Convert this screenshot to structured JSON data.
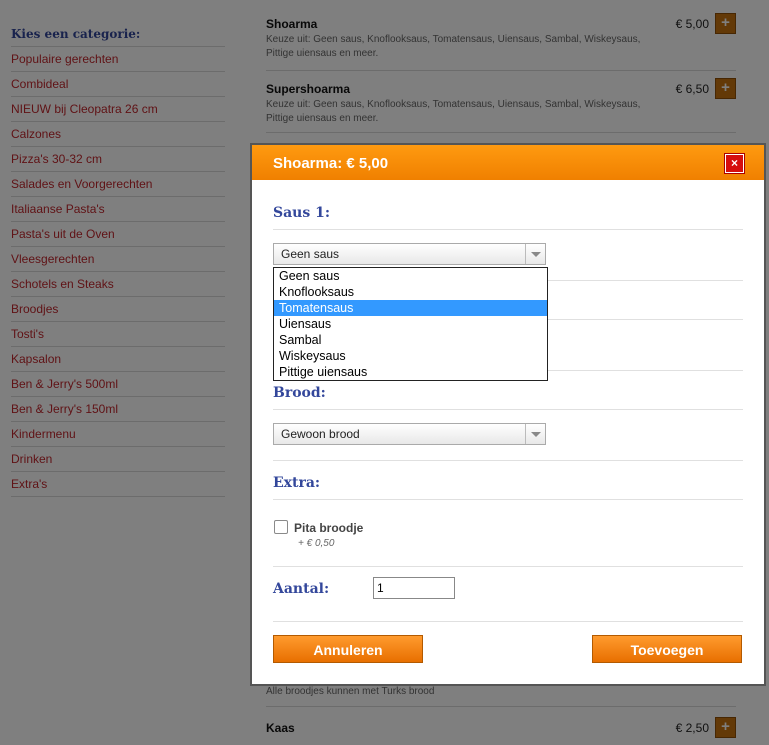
{
  "sidebar": {
    "title": "Kies een categorie:",
    "items": [
      "Populaire gerechten",
      "Combideal",
      "NIEUW bij Cleopatra 26 cm",
      "Calzones",
      "Pizza's 30-32 cm",
      "Salades en Voorgerechten",
      "Italiaanse Pasta's",
      "Pasta's uit de Oven",
      "Vleesgerechten",
      "Schotels en Steaks",
      "Broodjes",
      "Tosti's",
      "Kapsalon",
      "Ben & Jerry's 500ml",
      "Ben & Jerry's 150ml",
      "Kindermenu",
      "Drinken",
      "Extra's"
    ]
  },
  "menu": {
    "items": [
      {
        "name": "Shoarma",
        "desc": "Keuze uit: Geen saus, Knoflooksaus, Tomatensaus, Uiensaus, Sambal, Wiskeysaus, Pittige uiensaus en meer.",
        "price": "€ 5,00",
        "add": "+"
      },
      {
        "name": "Supershoarma",
        "desc": "Keuze uit: Geen saus, Knoflooksaus, Tomatensaus, Uiensaus, Sambal, Wiskeysaus, Pittige uiensaus en meer.",
        "price": "€ 6,50",
        "add": "+"
      },
      {
        "name": "Kaas",
        "desc": "",
        "price": "€ 2,50",
        "add": "+"
      }
    ],
    "note": "Alle broodjes kunnen met Turks brood"
  },
  "modal": {
    "title": "Shoarma: € 5,00",
    "close_icon": "×",
    "saus_heading": "Saus 1:",
    "saus_selected": "Geen saus",
    "saus_options": [
      "Geen saus",
      "Knoflooksaus",
      "Tomatensaus",
      "Uiensaus",
      "Sambal",
      "Wiskeysaus",
      "Pittige uiensaus"
    ],
    "saus_highlighted": "Tomatensaus",
    "brood_heading": "Brood:",
    "brood_selected": "Gewoon brood",
    "extra_heading": "Extra:",
    "extra_option_label": "Pita broodje",
    "extra_option_price": "+ € 0,50",
    "aantal_heading": "Aantal:",
    "aantal_value": "1",
    "cancel_label": "Annuleren",
    "add_label": "Toevoegen"
  },
  "colors": {
    "header_orange": "#ff8c00",
    "heading_blue": "#33479b",
    "category_red": "#c0262d",
    "highlight_blue": "#3399ff",
    "close_red": "#d60e0e"
  }
}
